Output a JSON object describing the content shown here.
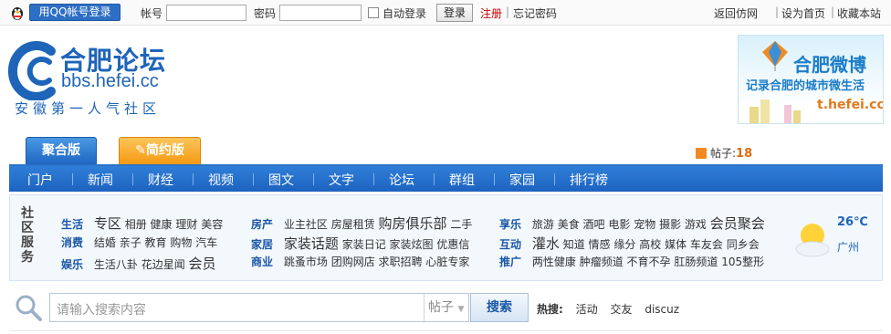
{
  "topbar": {
    "qq_login": "用QQ帐号登录",
    "account_label": "帐号",
    "password_label": "密码",
    "auto_login_label": "自动登录",
    "login_button": "登录",
    "register_link": "注册",
    "forgot_link": "忘记密码",
    "right_links": [
      "返回仿网",
      "设为首页",
      "收藏本站"
    ]
  },
  "logo": {
    "title": "合肥论坛",
    "url": "bbs.hefei.cc",
    "slogan": "安徽第一人气社区"
  },
  "weibo_banner": {
    "title": "合肥微博",
    "subtitle": "记录合肥的城市微生活",
    "url": "t.hefei.cc"
  },
  "tabs": [
    {
      "label": "聚合版",
      "active": true
    },
    {
      "label": "简约版",
      "active": false
    }
  ],
  "post_count": {
    "label": "帖子:",
    "value": "18"
  },
  "nav": [
    "门户",
    "新闻",
    "财经",
    "视频",
    "图文",
    "文字",
    "论坛",
    "群组",
    "家园",
    "排行榜"
  ],
  "community": {
    "side_title": "社区服务",
    "col1": [
      {
        "cat": "生活",
        "items": [
          "专区",
          "相册",
          "健康",
          "理财",
          "美容"
        ]
      },
      {
        "cat": "消费",
        "items": [
          "结婚",
          "亲子",
          "教育",
          "购物",
          "汽车"
        ]
      },
      {
        "cat": "娱乐",
        "items": [
          "生活八卦",
          "花边星闻",
          "会员"
        ]
      }
    ],
    "col2": [
      {
        "cat": "房产",
        "items": [
          "业主社区",
          "房屋租赁",
          "购房俱乐部",
          "二手"
        ]
      },
      {
        "cat": "家居",
        "items": [
          "家装话题",
          "家装日记",
          "家装炫图",
          "优惠信"
        ]
      },
      {
        "cat": "商业",
        "items": [
          "跳蚤市场",
          "团购网店",
          "求职招聘",
          "心脏专家"
        ]
      }
    ],
    "col3": [
      {
        "cat": "享乐",
        "items": [
          "旅游",
          "美食",
          "酒吧",
          "电影",
          "宠物",
          "摄影",
          "游戏",
          "会员聚会"
        ]
      },
      {
        "cat": "互动",
        "items": [
          "灌水",
          "知道",
          "情感",
          "缘分",
          "高校",
          "媒体",
          "车友会",
          "同乡会"
        ]
      },
      {
        "cat": "推广",
        "items": [
          "两性健康",
          "肿瘤频道",
          "不育不孕",
          "肛肠频道",
          "105整形"
        ]
      }
    ],
    "weather": {
      "temp": "26℃",
      "city": "广州",
      "icon": "sun-cloud-icon"
    }
  },
  "search": {
    "placeholder": "请输入搜索内容",
    "type": "帖子",
    "button": "搜索",
    "hot_label": "热搜:",
    "hot_items": [
      "活动",
      "交友",
      "discuz"
    ]
  },
  "colors": {
    "brand_blue": "#1e64b8",
    "nav_blue": "#2f7ed8",
    "orange": "#f39a12",
    "register_red": "#cc0000"
  }
}
